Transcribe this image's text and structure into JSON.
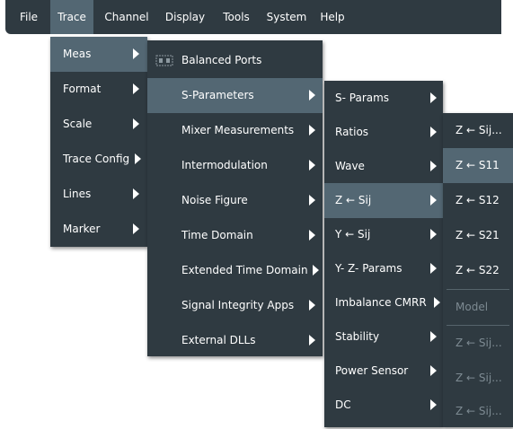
{
  "menubar": {
    "items": [
      {
        "label": "File"
      },
      {
        "label": "Trace"
      },
      {
        "label": "Channel"
      },
      {
        "label": "Display"
      },
      {
        "label": "Tools"
      },
      {
        "label": "System"
      },
      {
        "label": "Help"
      }
    ]
  },
  "trace_menu": {
    "items": [
      {
        "label": "Meas"
      },
      {
        "label": "Format"
      },
      {
        "label": "Scale"
      },
      {
        "label": "Trace Config"
      },
      {
        "label": "Lines"
      },
      {
        "label": "Marker"
      }
    ]
  },
  "meas_menu": {
    "items": [
      {
        "label": "Balanced Ports",
        "icon": "balanced-ports-icon"
      },
      {
        "label": "S-Parameters"
      },
      {
        "label": "Mixer Measurements"
      },
      {
        "label": "Intermodulation"
      },
      {
        "label": "Noise Figure"
      },
      {
        "label": "Time Domain"
      },
      {
        "label": "Extended Time Domain"
      },
      {
        "label": "Signal Integrity Apps"
      },
      {
        "label": "External DLLs"
      }
    ]
  },
  "sparams_menu": {
    "items": [
      {
        "label": "S- Params"
      },
      {
        "label": "Ratios"
      },
      {
        "label": "Wave"
      },
      {
        "label": "Z ← Sij"
      },
      {
        "label": "Y ← Sij"
      },
      {
        "label": "Y- Z-  Params"
      },
      {
        "label": "Imbalance CMRR"
      },
      {
        "label": "Stability"
      },
      {
        "label": "Power Sensor"
      },
      {
        "label": "DC"
      }
    ]
  },
  "z_sij_menu": {
    "items": [
      {
        "label": "Z ← Sij..."
      },
      {
        "label": "Z ← S11"
      },
      {
        "label": "Z ← S12"
      },
      {
        "label": "Z ← S21"
      },
      {
        "label": "Z ← S22"
      },
      {
        "label": "Model"
      },
      {
        "label": "Z ← Sij..."
      },
      {
        "label": "Z ← Sij..."
      },
      {
        "label": "Z ← Sij..."
      }
    ]
  },
  "colors": {
    "menu_bg": "#2f3a41",
    "highlight": "#536773",
    "disabled_text": "#7d8a92",
    "text": "#ffffff"
  }
}
